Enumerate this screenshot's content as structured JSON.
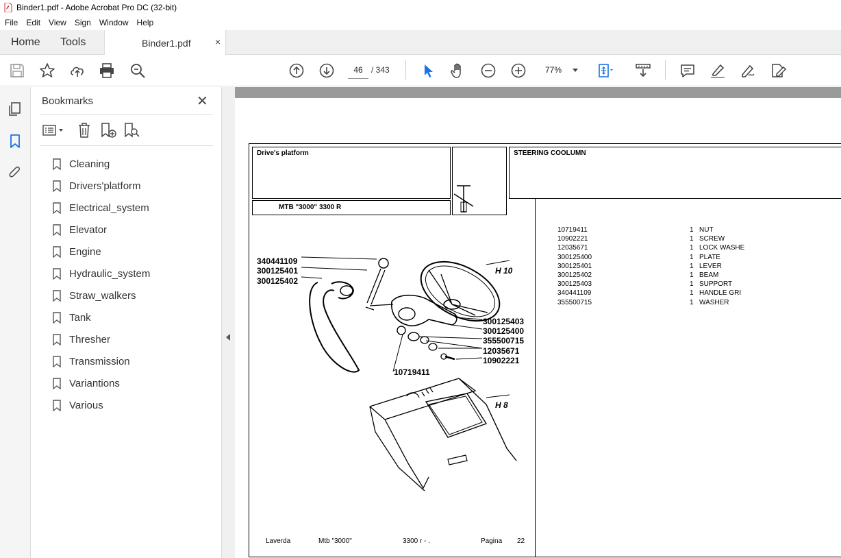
{
  "window": {
    "title": "Binder1.pdf - Adobe Acrobat Pro DC (32-bit)"
  },
  "menu": [
    "File",
    "Edit",
    "View",
    "Sign",
    "Window",
    "Help"
  ],
  "tabs": {
    "home": "Home",
    "tools": "Tools",
    "document": "Binder1.pdf",
    "close": "×"
  },
  "toolbar": {
    "page_current": "46",
    "page_total": "/ 343",
    "zoom": "77%"
  },
  "bookmarks": {
    "title": "Bookmarks",
    "items": [
      "Cleaning",
      "Drivers'platform",
      "Electrical_system",
      "Elevator",
      "Engine",
      "Hydraulic_system",
      "Straw_walkers",
      "Tank",
      "Thresher",
      "Transmission",
      "Variantions",
      "Various"
    ]
  },
  "document": {
    "section": "Drive's platform",
    "model": "MTB \"3000\"  3300 R",
    "group": "STEERING COOLUMN",
    "callouts": [
      "340441109",
      "300125401",
      "300125402",
      "H 10",
      "300125403",
      "300125400",
      "355500715",
      "12035671",
      "10902221",
      "10719411",
      "H 8"
    ],
    "parts": [
      {
        "pn": "10719411",
        "qty": "1",
        "desc": "NUT"
      },
      {
        "pn": "10902221",
        "qty": "1",
        "desc": "SCREW"
      },
      {
        "pn": "12035671",
        "qty": "1",
        "desc": "LOCK WASHE"
      },
      {
        "pn": "300125400",
        "qty": "1",
        "desc": "PLATE"
      },
      {
        "pn": "300125401",
        "qty": "1",
        "desc": "LEVER"
      },
      {
        "pn": "300125402",
        "qty": "1",
        "desc": "BEAM"
      },
      {
        "pn": "300125403",
        "qty": "1",
        "desc": "SUPPORT"
      },
      {
        "pn": "340441109",
        "qty": "1",
        "desc": "HANDLE GRI"
      },
      {
        "pn": "355500715",
        "qty": "1",
        "desc": "WASHER"
      }
    ],
    "footer": {
      "brand": "Laverda",
      "model": "Mtb \"3000\"",
      "variant": "3300 r - .",
      "page_label": "Pagina",
      "page_num": "22"
    }
  },
  "colors": {
    "accent": "#1a73e8",
    "pdf_red": "#d32f2f"
  }
}
